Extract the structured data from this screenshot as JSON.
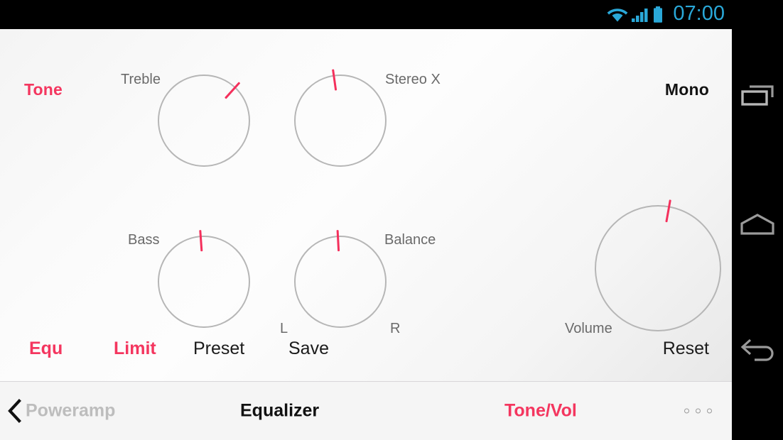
{
  "statusbar": {
    "time": "07:00",
    "accent_color": "#2aa8d8",
    "icons": [
      "wifi-icon",
      "signal-icon",
      "battery-icon"
    ]
  },
  "tone_panel": {
    "section_label": "Tone",
    "mono_label": "Mono",
    "accent_pink": "#f4365f",
    "knob_ring_color": "#b6b6b6",
    "knobs": [
      {
        "name": "Treble",
        "caption_side": "left",
        "tick_angle_deg": 42
      },
      {
        "name": "Stereo X",
        "caption_side": "right",
        "tick_angle_deg": -8
      },
      {
        "name": "Bass",
        "caption_side": "left",
        "tick_angle_deg": -4
      },
      {
        "name": "Balance",
        "caption_side": "right",
        "tick_angle_deg": -3,
        "min_label": "L",
        "max_label": "R"
      },
      {
        "name": "Volume",
        "caption_side": "left",
        "tick_angle_deg": 10
      }
    ],
    "actions": [
      {
        "label": "Equ",
        "active": true
      },
      {
        "label": "Limit",
        "active": true
      },
      {
        "label": "Preset",
        "active": false
      },
      {
        "label": "Save",
        "active": false
      },
      {
        "label": "Reset",
        "active": false
      }
    ]
  },
  "bottom_bar": {
    "back_label": "Poweramp",
    "title": "Equalizer",
    "tab_tone_vol": "Tone/Vol",
    "overflow_icon": "overflow-dots-icon"
  },
  "system_nav": {
    "buttons": [
      "recents-icon",
      "home-icon",
      "back-icon"
    ]
  }
}
